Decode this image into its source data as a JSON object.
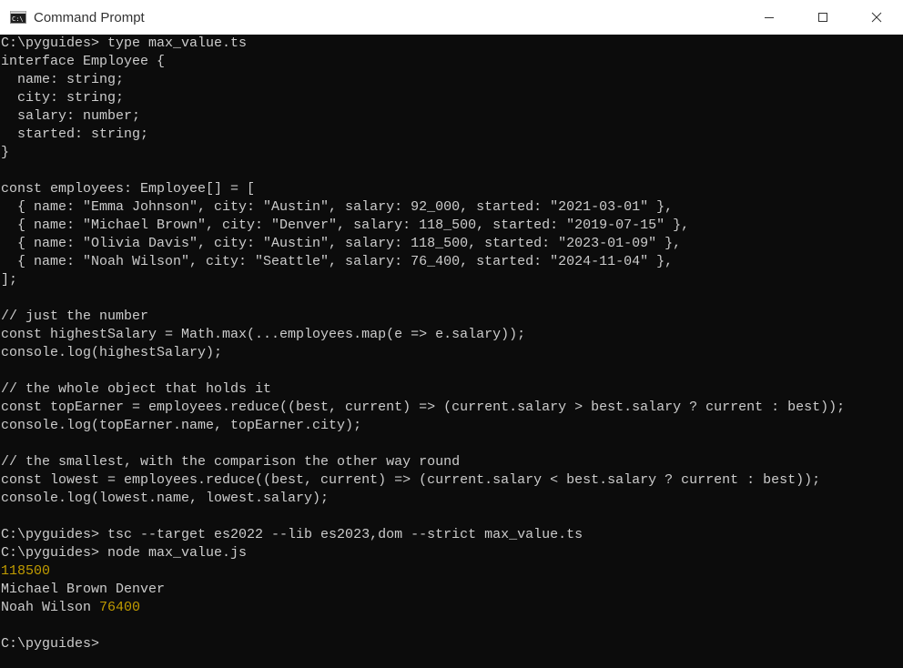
{
  "window": {
    "title": "Command Prompt",
    "icon": "cmd-icon",
    "controls": [
      "minimize-icon",
      "maximize-icon",
      "close-icon"
    ]
  },
  "console": {
    "colors": {
      "background": "#0c0c0c",
      "text": "#cccccc",
      "number": "#c19c00"
    },
    "lines": [
      "C:\\pyguides> type max_value.ts",
      "interface Employee {",
      "  name: string;",
      "  city: string;",
      "  salary: number;",
      "  started: string;",
      "}",
      "",
      "const employees: Employee[] = [",
      "  { name: \"Emma Johnson\", city: \"Austin\", salary: 92_000, started: \"2021-03-01\" },",
      "  { name: \"Michael Brown\", city: \"Denver\", salary: 118_500, started: \"2019-07-15\" },",
      "  { name: \"Olivia Davis\", city: \"Austin\", salary: 118_500, started: \"2023-01-09\" },",
      "  { name: \"Noah Wilson\", city: \"Seattle\", salary: 76_400, started: \"2024-11-04\" },",
      "];",
      "",
      "// just the number",
      "const highestSalary = Math.max(...employees.map(e => e.salary));",
      "console.log(highestSalary);",
      "",
      "// the whole object that holds it",
      "const topEarner = employees.reduce((best, current) => (current.salary > best.salary ? current : best));",
      "console.log(topEarner.name, topEarner.city);",
      "",
      "// the smallest, with the comparison the other way round",
      "const lowest = employees.reduce((best, current) => (current.salary < best.salary ? current : best));",
      "console.log(lowest.name, lowest.salary);",
      "",
      "C:\\pyguides> tsc --target es2022 --lib es2023,dom --strict max_value.ts",
      "C:\\pyguides> node max_value.js"
    ],
    "output": {
      "highest": "118500",
      "top_earner": "Michael Brown Denver",
      "lowest_name": "Noah Wilson ",
      "lowest_salary": "76400"
    },
    "blank": "",
    "prompt": "C:\\pyguides>"
  }
}
